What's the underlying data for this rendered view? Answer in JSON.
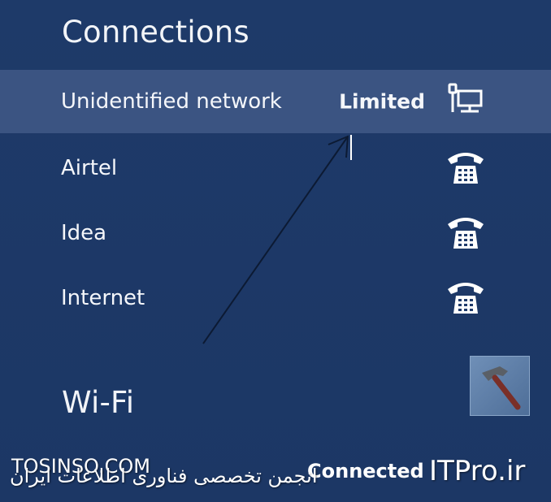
{
  "connections": {
    "title": "Connections",
    "items": [
      {
        "name": "Unidentified network",
        "status": "Limited",
        "icon": "wired-network-icon"
      },
      {
        "name": "Airtel",
        "status": "",
        "icon": "phone-icon"
      },
      {
        "name": "Idea",
        "status": "",
        "icon": "phone-icon"
      },
      {
        "name": "Internet",
        "status": "",
        "icon": "phone-icon"
      }
    ]
  },
  "wifi": {
    "title": "Wi-Fi",
    "item_status": "Connected"
  },
  "watermark": {
    "left": "TOSINSO.COM",
    "persian": "انجمن تخصصی فناوری اطلاعات ایران",
    "right": "ITPro.ir"
  },
  "colors": {
    "background": "#1f3a6a",
    "selected_row": "#3b5482",
    "text": "#ffffff"
  }
}
